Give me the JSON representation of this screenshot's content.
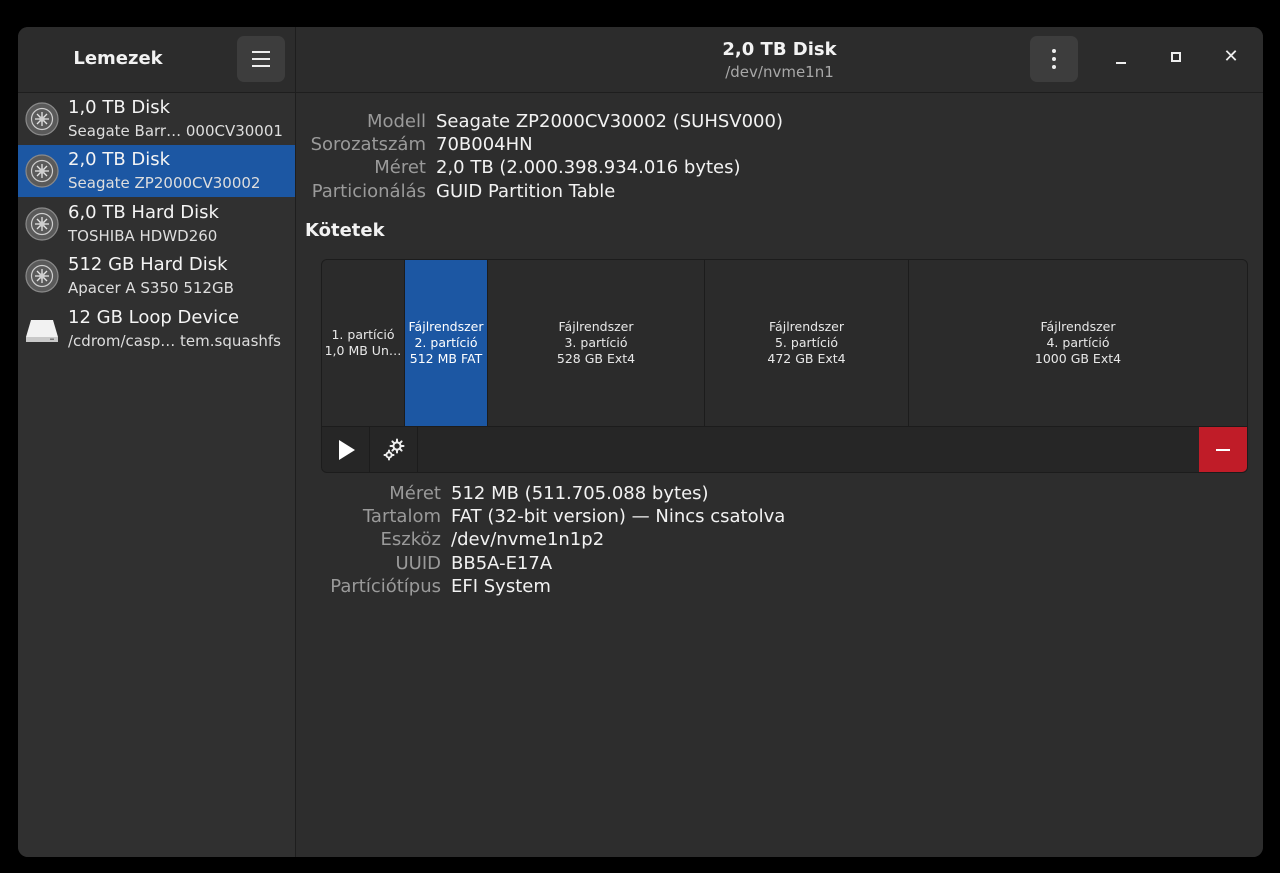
{
  "sidebar": {
    "title": "Lemezek",
    "disks": [
      {
        "name": "1,0 TB Disk",
        "sub": "Seagate Barr… 000CV30001",
        "icon": "disk-drive-icon"
      },
      {
        "name": "2,0 TB Disk",
        "sub": "Seagate ZP2000CV30002",
        "icon": "disk-drive-icon"
      },
      {
        "name": "6,0 TB Hard Disk",
        "sub": "TOSHIBA HDWD260",
        "icon": "disk-drive-icon"
      },
      {
        "name": "512 GB Hard Disk",
        "sub": "Apacer A S350 512GB",
        "icon": "disk-drive-icon"
      },
      {
        "name": "12 GB Loop Device",
        "sub": "/cdrom/casp… tem.squashfs",
        "icon": "loop-device-icon"
      }
    ]
  },
  "header": {
    "title": "2,0 TB Disk",
    "subtitle": "/dev/nvme1n1"
  },
  "disk_info": [
    {
      "key": "Modell",
      "value": "Seagate ZP2000CV30002 (SUHSV000)"
    },
    {
      "key": "Sorozatszám",
      "value": "70B004HN"
    },
    {
      "key": "Méret",
      "value": "2,0 TB (2.000.398.934.016 bytes)"
    },
    {
      "key": "Particionálás",
      "value": "GUID Partition Table"
    }
  ],
  "volumes": {
    "title": "Kötetek",
    "partitions": [
      {
        "line1": "1. partíció",
        "line2": "1,0 MB Un…",
        "line3": ""
      },
      {
        "line1": "Fájlrendszer",
        "line2": "2. partíció",
        "line3": "512 MB FAT"
      },
      {
        "line1": "Fájlrendszer",
        "line2": "3. partíció",
        "line3": "528 GB Ext4"
      },
      {
        "line1": "Fájlrendszer",
        "line2": "5. partíció",
        "line3": "472 GB Ext4"
      },
      {
        "line1": "Fájlrendszer",
        "line2": "4. partíció",
        "line3": "1000 GB Ext4"
      }
    ]
  },
  "volume_info": [
    {
      "key": "Méret",
      "value": "512 MB (511.705.088 bytes)"
    },
    {
      "key": "Tartalom",
      "value": "FAT (32-bit version) — Nincs csatolva"
    },
    {
      "key": "Eszköz",
      "value": "/dev/nvme1n1p2"
    },
    {
      "key": "UUID",
      "value": "BB5A-E17A"
    },
    {
      "key": "Partíciótípus",
      "value": "EFI System"
    }
  ],
  "colors": {
    "accent": "#1c57a3",
    "danger": "#c01c28"
  }
}
